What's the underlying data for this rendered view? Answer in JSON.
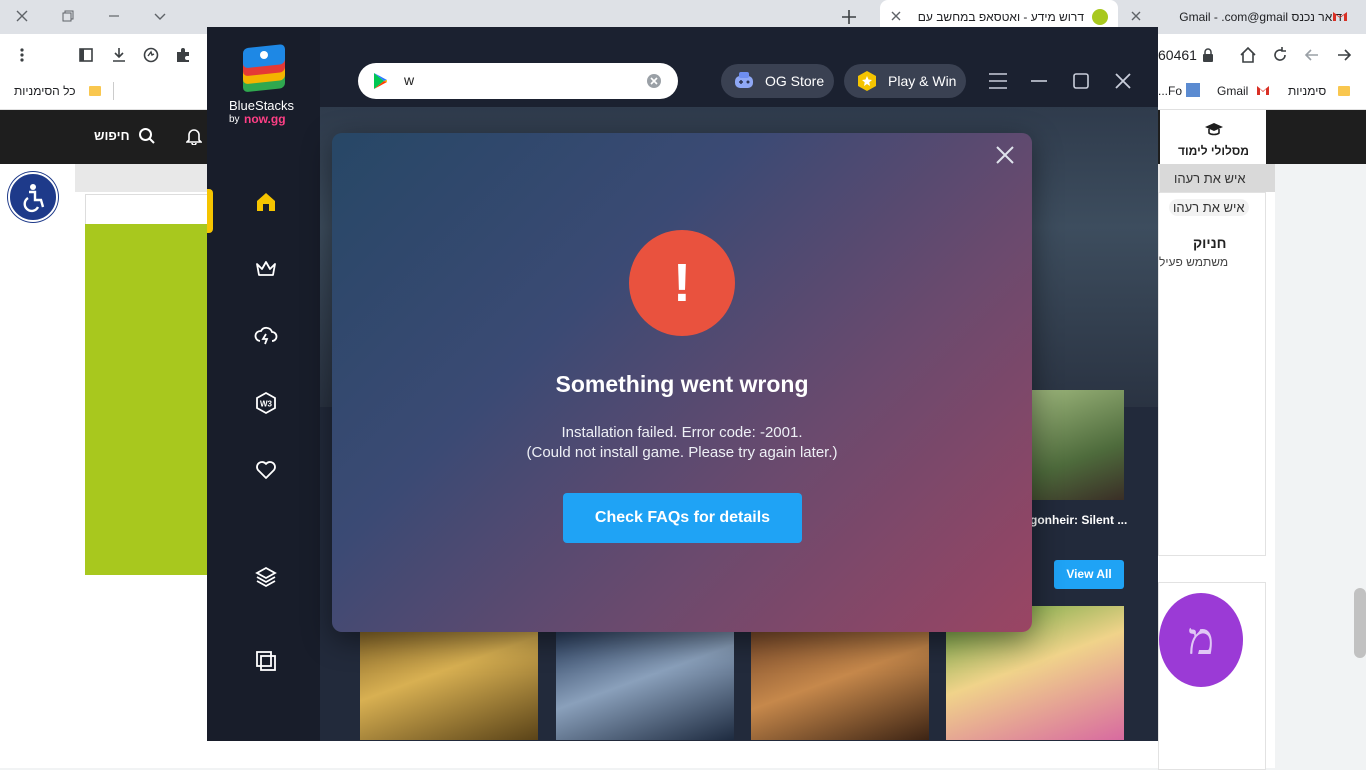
{
  "browser": {
    "tabs": [
      {
        "title": "דרוש מידע - ואטסאפ במחשב עם"
      },
      {
        "title": "דואר נכנס Gmail - .com@gmail"
      }
    ],
    "address_partial": "60461",
    "bookmarks": {
      "all_bookmarks": "כל הסימניות",
      "bookmarks": "סימניות",
      "gmail": "Gmail",
      "truncated": "Fo..."
    }
  },
  "site": {
    "search_label": "חיפוש",
    "learning_paths": "מסלולי לימוד",
    "post_label_1": "איש את רעהו",
    "post_label_2": "איש את רעהו",
    "user_name": "חניוק",
    "user_status": "משתמש פעיל",
    "avatar_letter": "מ"
  },
  "bluestacks": {
    "logo_name": "BlueStacks",
    "logo_by": "by",
    "logo_brand": "now.gg",
    "search_value": "w",
    "og_store": "OG Store",
    "play_win": "Play & Win",
    "game_title": "gonheir: Silent ...",
    "view_all": "View All",
    "sidebar": [
      "home-icon",
      "crown-icon",
      "cloud-download-icon",
      "web3-icon",
      "heart-icon",
      "layers-icon",
      "multi-instance-icon"
    ]
  },
  "modal": {
    "title": "Something went wrong",
    "message_line1": "Installation failed. Error code: -2001.",
    "message_line2": "(Could not install game. Please try again later.)",
    "faq_button": "Check FAQs for details",
    "error_glyph": "!"
  },
  "colors": {
    "accent_blue": "#1fa3f5",
    "error_red": "#e9523e",
    "active_yellow": "#f5c400",
    "site_green": "#a8c81e",
    "avatar_purple": "#9b3ad6"
  }
}
